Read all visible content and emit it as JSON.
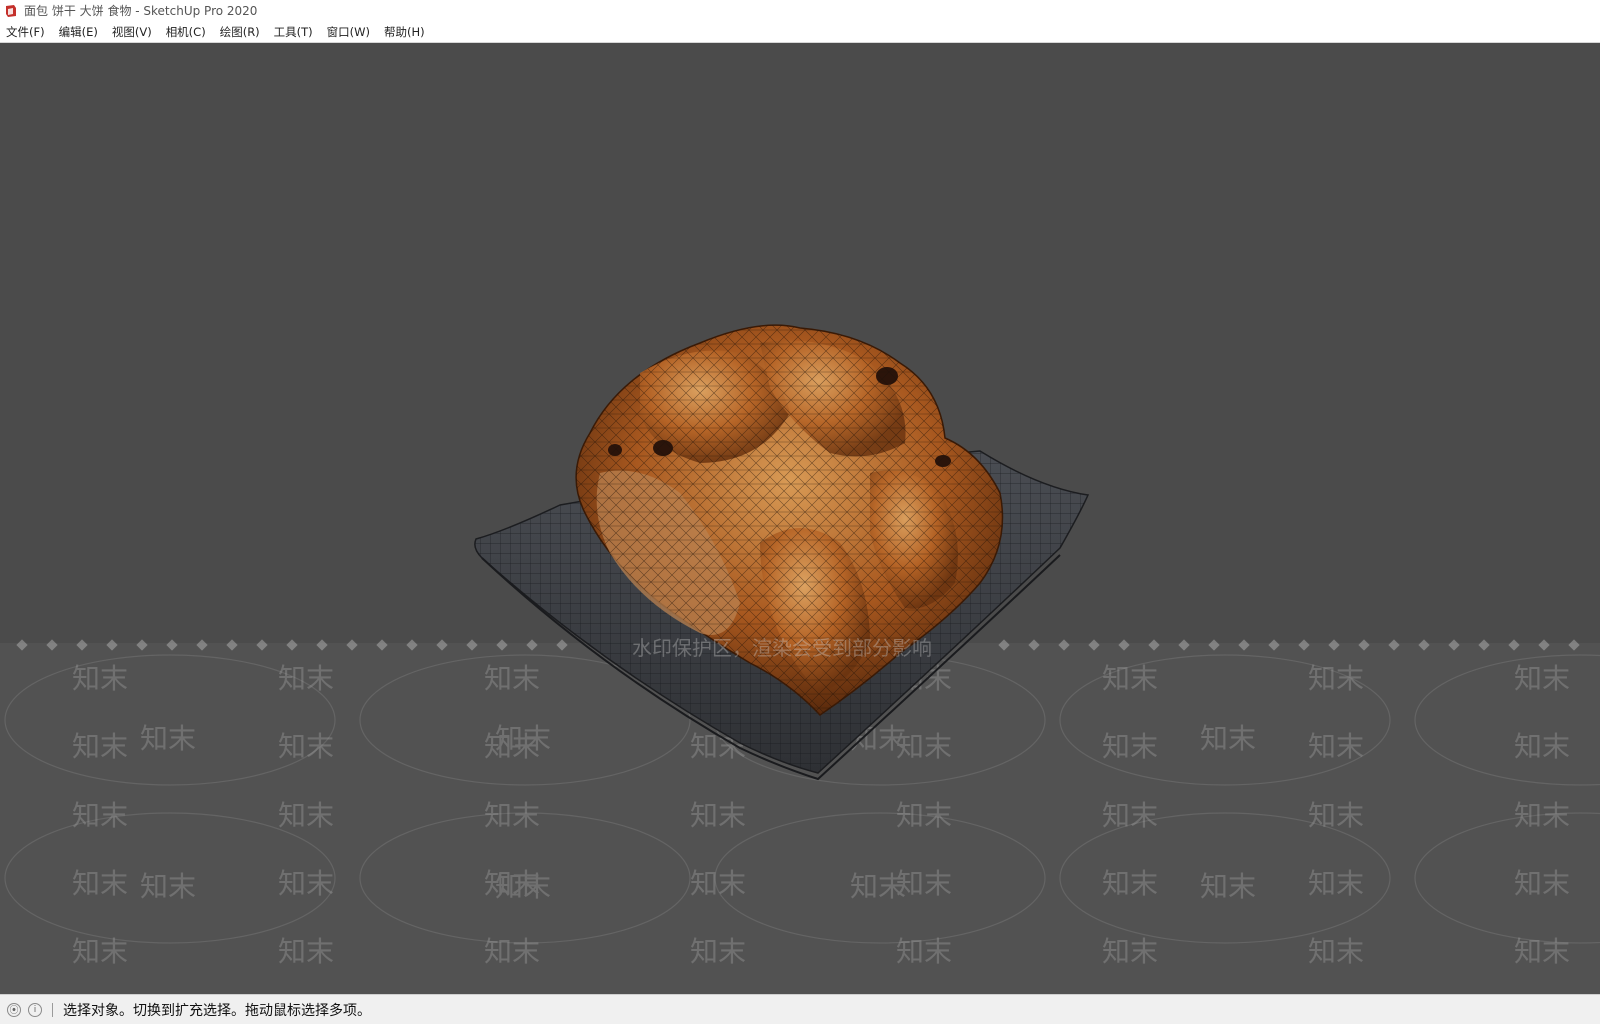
{
  "window": {
    "title": "面包 饼干 大饼 食物 - SketchUp Pro 2020"
  },
  "menu": [
    {
      "label": "文件(F)"
    },
    {
      "label": "编辑(E)"
    },
    {
      "label": "视图(V)"
    },
    {
      "label": "相机(C)"
    },
    {
      "label": "绘图(R)"
    },
    {
      "label": "工具(T)"
    },
    {
      "label": "窗口(W)"
    },
    {
      "label": "帮助(H)"
    }
  ],
  "viewport": {
    "background": "#4b4b4b",
    "model": "bread-on-plate",
    "watermark_text": "知末",
    "watermark_notice": "水印保护区，渲染会受到部分影响"
  },
  "status": {
    "icons": [
      "geo-location-icon",
      "info-icon"
    ],
    "message": "选择对象。切换到扩充选择。拖动鼠标选择多项。"
  },
  "colors": {
    "app_icon_red": "#c4302b",
    "bread_dark": "#6b3410",
    "bread_mid": "#a8581f",
    "bread_light": "#c98a4a",
    "plate": "#3c3f44"
  }
}
